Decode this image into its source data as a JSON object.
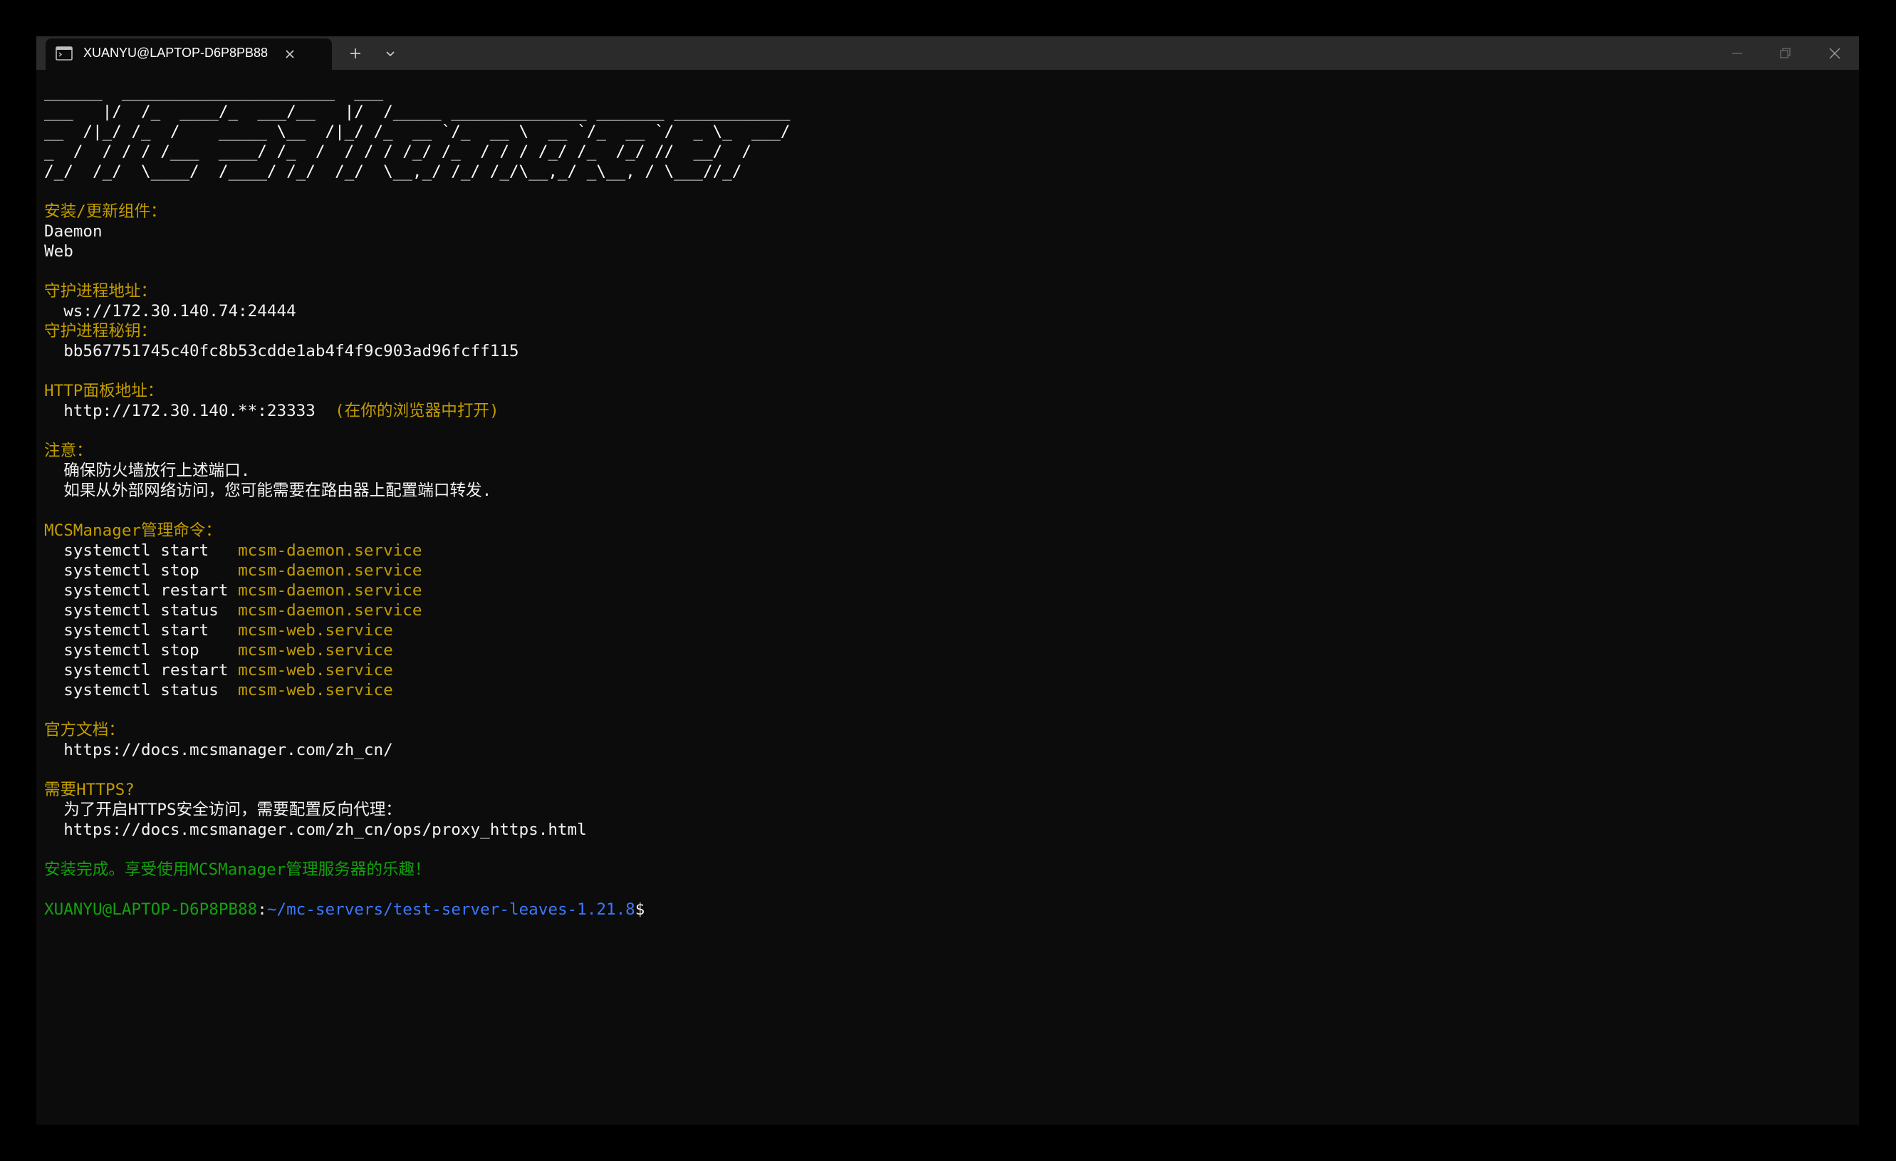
{
  "window": {
    "tab_title": "XUANYU@LAPTOP-D6P8PB88",
    "tab_icon": "terminal-icon",
    "buttons": [
      "new-tab-icon",
      "chevron-down-icon",
      "minimize-icon",
      "maximize-icon",
      "close-icon"
    ]
  },
  "colors": {
    "background": "#0c0c0c",
    "titlebar": "#2b2b2b",
    "heading_yellow": "#c19c00",
    "success_green": "#13a10e",
    "path_blue": "#3b78ff",
    "text": "#cccccc"
  },
  "terminal": {
    "banner": [
      "______  ______________________  ___",
      "___   |/  /_  ____/_  ___/__   |/  /_____ ______________ _______ ____________",
      "__  /|_/ /_  /    _____ \\__  /|_/ /_  __ `/_  __ \\  __ `/_  __ `/  _ \\_  ___/",
      "_  /  / / / /___  ____/ /_  /  / / / /_/ /_  / / / /_/ /_  /_/ //  __/  /",
      "/_/  /_/  \\____/  /____/ /_/  /_/  \\__,_/ /_/ /_/\\__,_/ _\\__, / \\___//_/"
    ],
    "components_heading": "安装/更新组件：",
    "components": [
      "Daemon",
      "Web"
    ],
    "daemon_addr_heading": "守护进程地址：",
    "daemon_addr": "  ws://172.30.140.74:24444",
    "daemon_key_heading": "守护进程秘钥：",
    "daemon_key": "  bb567751745c40fc8b53cdde1ab4f4f9c903ad96fcff115",
    "http_heading": "HTTP面板地址：",
    "http_addr": "  http://172.30.140.**:23333",
    "http_note": "  (在你的浏览器中打开)",
    "notes_heading": "注意：",
    "notes": [
      "  确保防火墙放行上述端口.",
      "  如果从外部网络访问，您可能需要在路由器上配置端口转发."
    ],
    "commands_heading": "MCSManager管理命令：",
    "commands": [
      {
        "cmd": "  systemctl start   ",
        "service": "mcsm-daemon.service"
      },
      {
        "cmd": "  systemctl stop    ",
        "service": "mcsm-daemon.service"
      },
      {
        "cmd": "  systemctl restart ",
        "service": "mcsm-daemon.service"
      },
      {
        "cmd": "  systemctl status  ",
        "service": "mcsm-daemon.service"
      },
      {
        "cmd": "  systemctl start   ",
        "service": "mcsm-web.service"
      },
      {
        "cmd": "  systemctl stop    ",
        "service": "mcsm-web.service"
      },
      {
        "cmd": "  systemctl restart ",
        "service": "mcsm-web.service"
      },
      {
        "cmd": "  systemctl status  ",
        "service": "mcsm-web.service"
      }
    ],
    "docs_heading": "官方文档：",
    "docs_url": "  https://docs.mcsmanager.com/zh_cn/",
    "https_heading": "需要HTTPS?",
    "https_text": "  为了开启HTTPS安全访问，需要配置反向代理：",
    "https_url": "  https://docs.mcsmanager.com/zh_cn/ops/proxy_https.html",
    "success": "安装完成。享受使用MCSManager管理服务器的乐趣！",
    "prompt": {
      "user_host": "XUANYU@LAPTOP-D6P8PB88",
      "colon": ":",
      "path": "~/mc-servers/test-server-leaves-1.21.8",
      "symbol": "$"
    }
  }
}
